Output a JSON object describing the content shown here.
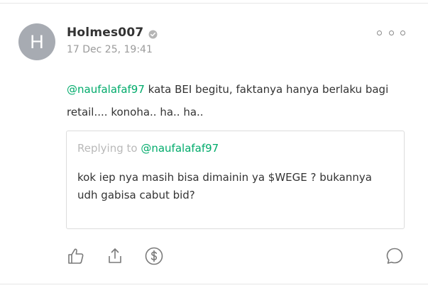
{
  "post": {
    "avatar_initial": "H",
    "username": "Holmes007",
    "timestamp": "17 Dec 25, 19:41",
    "mention": "@naufalafaf97",
    "body_text": " kata BEI begitu, faktanya hanya berlaku bagi retail.... konoha.. ha.. ha.."
  },
  "quoted": {
    "replying_label": "Replying to ",
    "replying_mention": "@naufalafaf97",
    "text": "kok iep nya masih bisa dimainin ya $WEGE ? bukannya udh gabisa cabut bid?"
  },
  "icons": {
    "verified": "verified-badge-icon",
    "more": "more-options-icon",
    "like": "thumbs-up-icon",
    "share": "share-icon",
    "tip": "dollar-coin-icon",
    "comment": "comment-bubble-icon"
  },
  "colors": {
    "accent": "#00ab6b",
    "avatar_bg": "#a7abb2",
    "muted_text": "#9b9b9b",
    "body_text": "#333333",
    "icon": "#7a7a7a"
  }
}
